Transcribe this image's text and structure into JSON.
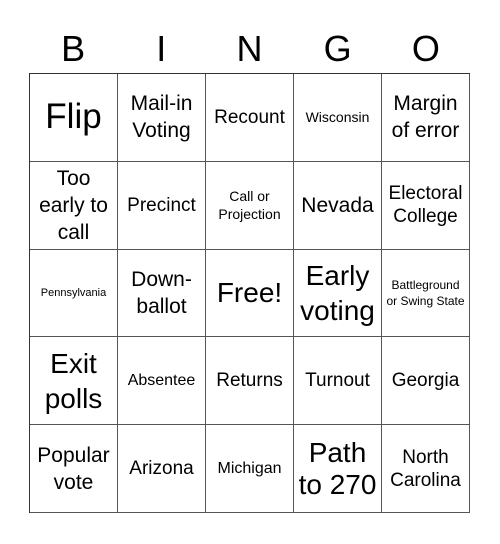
{
  "header": {
    "letters": [
      "B",
      "I",
      "N",
      "G",
      "O"
    ]
  },
  "card": {
    "rows": [
      [
        "Flip",
        "Mail-in Voting",
        "Recount",
        "Wisconsin",
        "Margin of error"
      ],
      [
        "Too early to call",
        "Precinct",
        "Call or Projection",
        "Nevada",
        "Electoral College"
      ],
      [
        "Pennsylvania",
        "Down-ballot",
        "Free!",
        "Early voting",
        "Battleground or Swing State"
      ],
      [
        "Exit polls",
        "Absentee",
        "Returns",
        "Turnout",
        "Georgia"
      ],
      [
        "Popular vote",
        "Arizona",
        "Michigan",
        "Path to 270",
        "North Carolina"
      ]
    ],
    "free_space": "Free!"
  },
  "colors": {
    "grid_line": "#555555",
    "text": "#000000",
    "background": "#ffffff"
  }
}
